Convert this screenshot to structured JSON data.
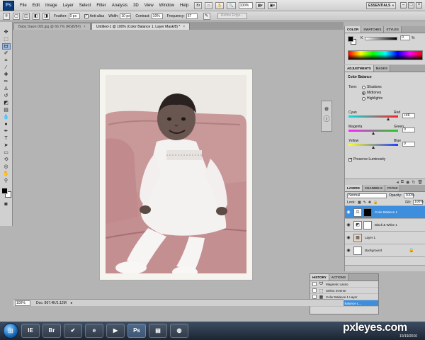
{
  "app": {
    "logo": "Ps",
    "menu": [
      "File",
      "Edit",
      "Image",
      "Layer",
      "Select",
      "Filter",
      "Analysis",
      "3D",
      "View",
      "Window",
      "Help"
    ],
    "zoom_field": "100%",
    "workspace": "ESSENTIALS",
    "window_buttons": [
      "–",
      "□",
      "×"
    ]
  },
  "options": {
    "feather_label": "Feather:",
    "feather_value": "0 px",
    "antialias_label": "Anti-alias",
    "width_label": "Width:",
    "width_value": "10 px",
    "contrast_label": "Contrast:",
    "contrast_value": "10%",
    "frequency_label": "Frequency:",
    "frequency_value": "57",
    "refine_edge": "Refine Edge..."
  },
  "doc_tabs": [
    {
      "label": "Baby Dawn 005.jpg @ 66.7% (RGB/8#)",
      "active": false
    },
    {
      "label": "Untitled-1 @ 100% (Color Balance 1, Layer Mask/8) *",
      "active": true
    }
  ],
  "color_panel": {
    "tabs": [
      "COLOR",
      "SWATCHES",
      "STYLES"
    ],
    "k_label": "K",
    "k_value": "0",
    "k_unit": "%"
  },
  "adjustments": {
    "tabs": [
      "ADJUSTMENTS",
      "MASKS"
    ],
    "title": "Color Balance",
    "tone_label": "Tone:",
    "tones": [
      {
        "label": "Shadows",
        "selected": false
      },
      {
        "label": "Midtones",
        "selected": true
      },
      {
        "label": "Highlights",
        "selected": false
      }
    ],
    "sliders": [
      {
        "left": "Cyan",
        "right": "Red",
        "value": "+46",
        "position": 0.8,
        "colors": [
          "#00e0e0",
          "#ff2020"
        ]
      },
      {
        "left": "Magenta",
        "right": "Green",
        "value": "0",
        "position": 0.5,
        "colors": [
          "#ff20ff",
          "#20d020"
        ]
      },
      {
        "left": "Yellow",
        "right": "Blue",
        "value": "0",
        "position": 0.5,
        "colors": [
          "#ffff20",
          "#2040ff"
        ]
      }
    ],
    "preserve_label": "Preserve Luminosity"
  },
  "layers": {
    "tabs": [
      "LAYERS",
      "CHANNELS",
      "PATHS"
    ],
    "blend_mode": "Normal",
    "opacity_label": "Opacity:",
    "opacity_value": "100%",
    "lock_label": "Lock:",
    "fill_label": "Fill:",
    "fill_value": "100%",
    "items": [
      {
        "name": "Color Balance 1",
        "selected": true,
        "thumb": "⚖",
        "mask": true
      },
      {
        "name": "Black & White 1",
        "selected": false,
        "thumb": "◩",
        "mask": true
      },
      {
        "name": "Layer 1",
        "selected": false,
        "thumb": "▦",
        "mask": false
      },
      {
        "name": "Background",
        "selected": false,
        "thumb": "",
        "mask": false,
        "locked": true
      }
    ]
  },
  "history": {
    "tabs": [
      "HISTORY",
      "ACTIONS"
    ],
    "items": [
      {
        "label": "Magnetic Lasso",
        "selected": false
      },
      {
        "label": "Select Inverse",
        "selected": false
      },
      {
        "label": "Color Balance 1 Layer",
        "selected": false
      },
      {
        "label": "Modify Color Balance L...",
        "selected": true
      }
    ]
  },
  "status": {
    "zoom": "100%",
    "doc": "Doc: 867.4K/1.12M"
  },
  "taskbar": {
    "buttons": [
      "IE",
      "Br",
      "✔",
      "e",
      "▶",
      "Ps",
      "▤",
      "◍"
    ],
    "active_index": 5,
    "watermark": "pxleyes.com",
    "date": "10/19/2010"
  }
}
